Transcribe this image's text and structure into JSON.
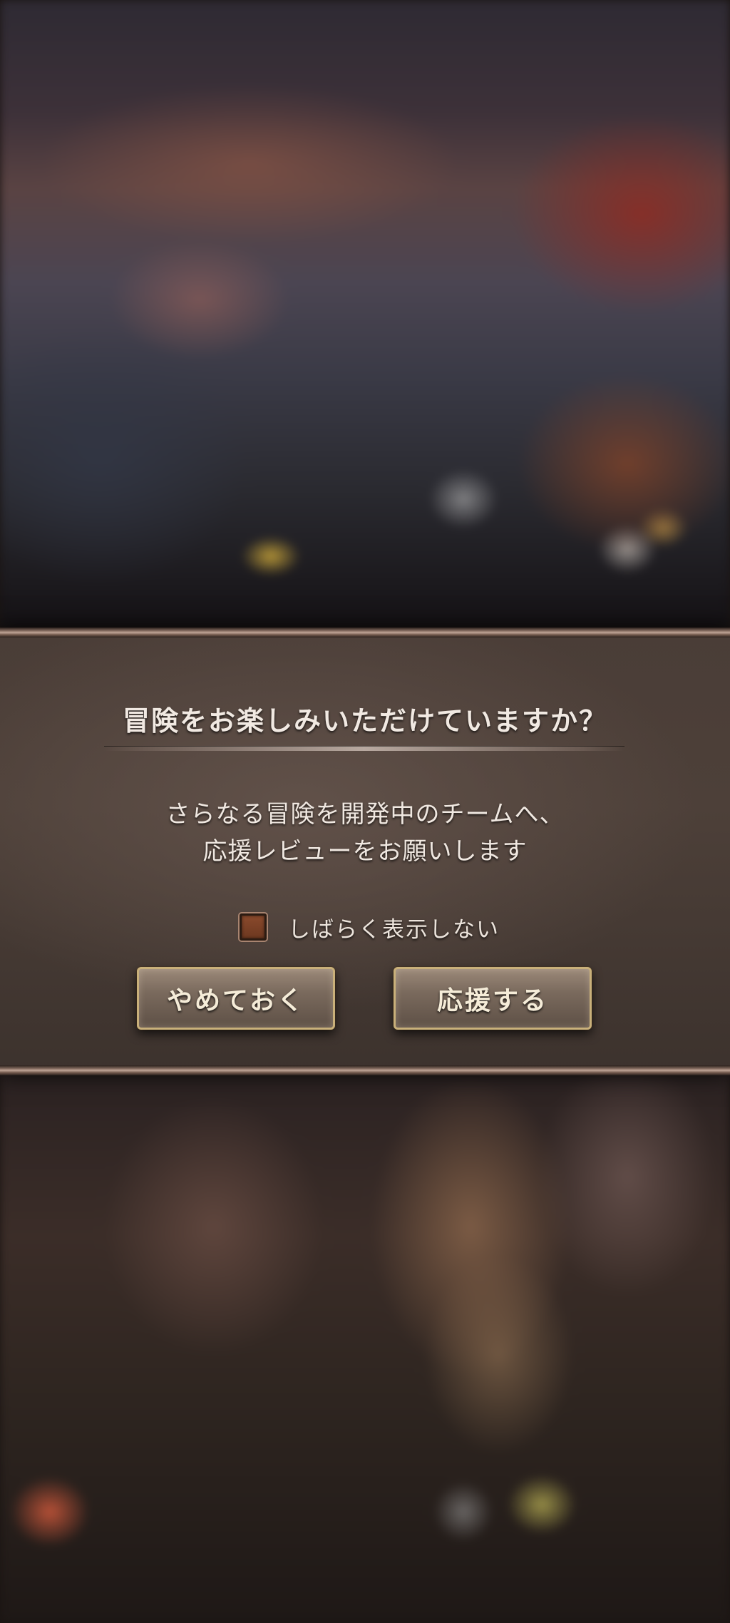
{
  "dialog": {
    "title": "冒険をお楽しみいただけていますか？",
    "message_line1": "さらなる冒険を開発中のチームへ、",
    "message_line2": "応援レビューをお願いします",
    "dont_show_label": "しばらく表示しない",
    "dont_show_checked": false,
    "cancel_label": "やめておく",
    "review_label": "応援する"
  },
  "colors": {
    "dialog_bg": "#4a3d37",
    "button_border": "#c9b07a",
    "text": "#f1e9e2"
  }
}
